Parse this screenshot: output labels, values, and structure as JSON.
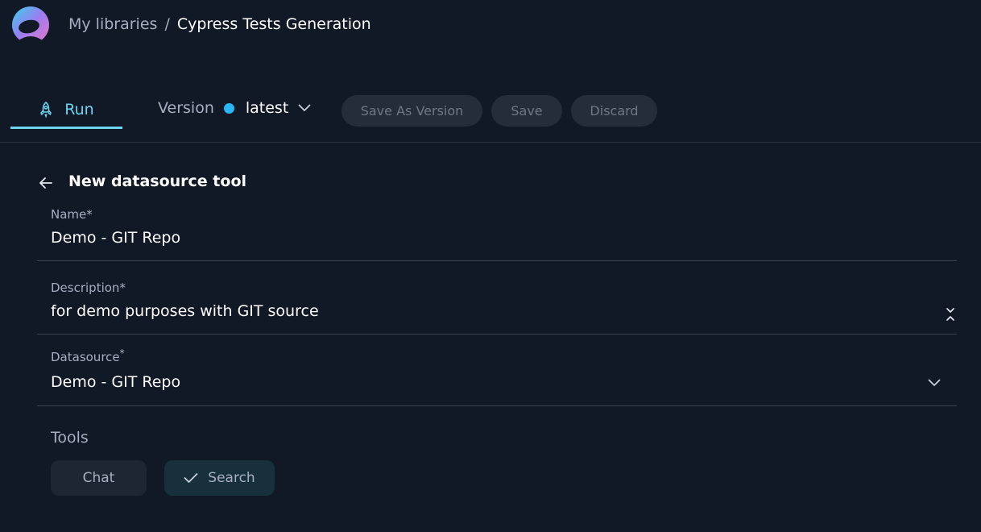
{
  "header": {
    "breadcrumb": {
      "parent": "My libraries",
      "separator": "/",
      "current": "Cypress Tests Generation"
    },
    "logo_icon": "app-logo-icon"
  },
  "toolbar": {
    "run_tab": {
      "label": "Run",
      "icon": "rocket-icon",
      "active": true
    },
    "version": {
      "label": "Version",
      "status_color": "#29b8f5",
      "value": "latest",
      "icon": "chevron-down-icon"
    },
    "buttons": {
      "save_as_version": "Save As Version",
      "save": "Save",
      "discard": "Discard"
    }
  },
  "form": {
    "title": "New datasource tool",
    "back_icon": "arrow-left-icon",
    "name": {
      "label": "Name",
      "required_mark": "*",
      "value": "Demo - GIT Repo"
    },
    "description": {
      "label": "Description",
      "required_mark": "*",
      "value": "for demo purposes with GIT source",
      "icon": "resize-icon"
    },
    "datasource": {
      "label": "Datasource",
      "required_mark": "*",
      "value": "Demo - GIT Repo",
      "icon": "chevron-down-icon"
    },
    "tools": {
      "label": "Tools",
      "options": [
        {
          "label": "Chat",
          "selected": false
        },
        {
          "label": "Search",
          "selected": true,
          "icon": "check-icon"
        }
      ]
    }
  },
  "colors": {
    "background": "#111826",
    "accent": "#6ad6f1",
    "status_dot": "#29b8f5",
    "muted_text": "#a6b0c2",
    "button_bg": "#262d3a",
    "selected_chip_bg": "#17303b"
  }
}
